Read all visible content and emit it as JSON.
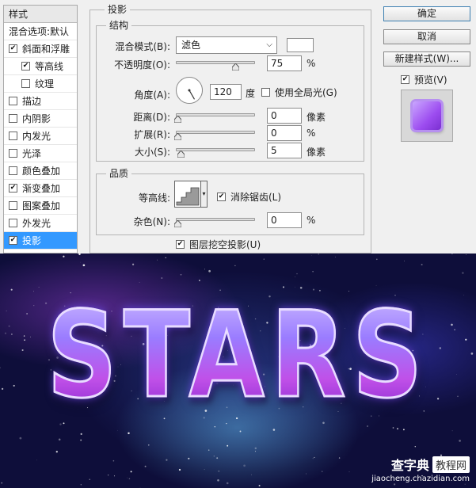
{
  "styles_panel": {
    "header": "样式",
    "blend_options": "混合选项:默认",
    "items": [
      {
        "label": "斜面和浮雕",
        "checked": true,
        "indent": false
      },
      {
        "label": "等高线",
        "checked": true,
        "indent": true
      },
      {
        "label": "纹理",
        "checked": false,
        "indent": true
      },
      {
        "label": "描边",
        "checked": false,
        "indent": false
      },
      {
        "label": "内阴影",
        "checked": false,
        "indent": false
      },
      {
        "label": "内发光",
        "checked": false,
        "indent": false
      },
      {
        "label": "光泽",
        "checked": false,
        "indent": false
      },
      {
        "label": "颜色叠加",
        "checked": false,
        "indent": false
      },
      {
        "label": "渐变叠加",
        "checked": true,
        "indent": false
      },
      {
        "label": "图案叠加",
        "checked": false,
        "indent": false
      },
      {
        "label": "外发光",
        "checked": false,
        "indent": false
      },
      {
        "label": "投影",
        "checked": true,
        "indent": false,
        "selected": true
      }
    ]
  },
  "drop_shadow": {
    "title": "投影",
    "structure": {
      "title": "结构",
      "blend_mode_label": "混合模式(B):",
      "blend_mode_value": "滤色",
      "opacity_label": "不透明度(O):",
      "opacity_value": "75",
      "opacity_unit": "%",
      "opacity_fraction": 0.75,
      "angle_label": "角度(A):",
      "angle_value": "120",
      "angle_unit": "度",
      "global_light_label": "使用全局光(G)",
      "global_light_checked": false,
      "distance_label": "距离(D):",
      "distance_value": "0",
      "distance_unit": "像素",
      "spread_label": "扩展(R):",
      "spread_value": "0",
      "spread_unit": "%",
      "size_label": "大小(S):",
      "size_value": "5",
      "size_unit": "像素"
    },
    "quality": {
      "title": "品质",
      "contour_label": "等高线:",
      "antialias_label": "消除锯齿(L)",
      "antialias_checked": true,
      "noise_label": "杂色(N):",
      "noise_value": "0",
      "noise_unit": "%"
    },
    "knockout_label": "图层挖空投影(U)",
    "knockout_checked": true
  },
  "buttons": {
    "ok": "确定",
    "cancel": "取消",
    "new_style": "新建样式(W)...",
    "preview_label": "预览(V)",
    "preview_checked": true
  },
  "artwork": {
    "text": "STARS",
    "watermark_title": "查字典",
    "watermark_box": "教程网",
    "watermark_url": "jiaocheng.chazidian.com"
  }
}
